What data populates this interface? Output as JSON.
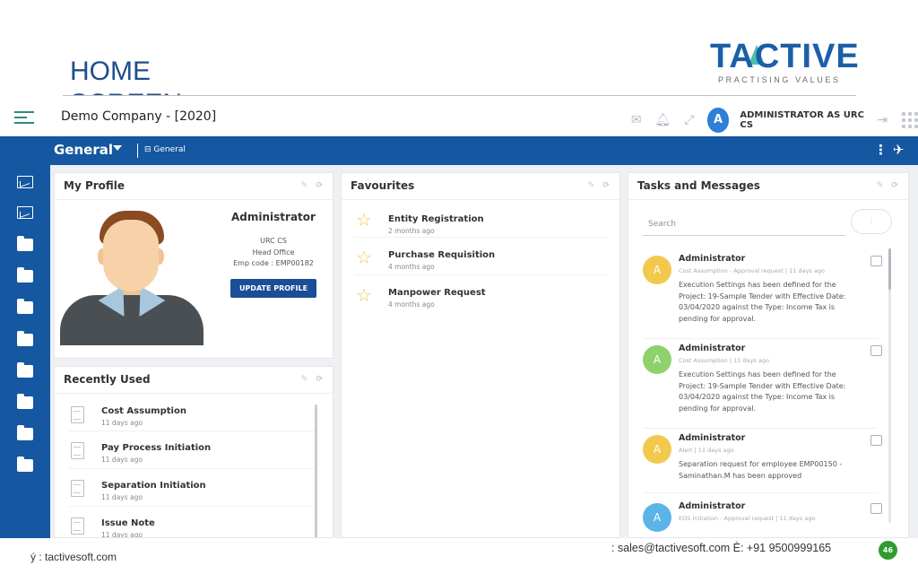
{
  "slide": {
    "title_line1": "HOME",
    "title_line2": "SCREEN",
    "logo_text": "TACTIVE",
    "logo_tagline": "PRACTISING VALUES"
  },
  "topbar": {
    "company": "Demo Company - [2020]",
    "avatar_letter": "A",
    "user": "ADMINISTRATOR AS URC CS",
    "icons": [
      "mail-icon",
      "bell-icon",
      "expand-icon",
      "logout-icon",
      "apps-grid-icon"
    ]
  },
  "nav": {
    "title": "General",
    "crumb": "⊟ General",
    "menu_glyph": "⋮",
    "pin_glyph": "✈"
  },
  "sidebar": {
    "items": [
      "chart-icon",
      "chart-icon",
      "folder-icon",
      "folder-icon",
      "folder-icon",
      "folder-icon",
      "folder-icon",
      "folder-icon",
      "folder-icon",
      "folder-icon"
    ]
  },
  "profile": {
    "heading": "My Profile",
    "name": "Administrator",
    "company": "URC CS",
    "office": "Head Office",
    "emp_code": "Emp code : EMP00182",
    "button": "UPDATE PROFILE"
  },
  "recent": {
    "heading": "Recently Used",
    "items": [
      {
        "title": "Cost Assumption",
        "time": "11 days ago"
      },
      {
        "title": "Pay Process Initiation",
        "time": "11 days ago"
      },
      {
        "title": "Separation Initiation",
        "time": "11 days ago"
      },
      {
        "title": "Issue Note",
        "time": "11 days ago"
      }
    ]
  },
  "favourites": {
    "heading": "Favourites",
    "items": [
      {
        "title": "Entity Registration",
        "time": "2 months ago"
      },
      {
        "title": "Purchase Requisition",
        "time": "4 months ago"
      },
      {
        "title": "Manpower Request",
        "time": "4 months ago"
      }
    ]
  },
  "tasks": {
    "heading": "Tasks and Messages",
    "search_placeholder": "Search",
    "messages": [
      {
        "letter": "A",
        "color": "#f2c94c",
        "name": "Administrator",
        "meta": "Cost Assumption - Approval request | 11 days ago",
        "text": "Execution Settings has been defined for the Project: 19-Sample Tender with Effective Date: 03/04/2020 against the Type: Income Tax is pending for approval."
      },
      {
        "letter": "A",
        "color": "#8fd16c",
        "name": "Administrator",
        "meta": "Cost Assumption | 11 days ago",
        "text": "Execution Settings has been defined for the Project: 19-Sample Tender with Effective Date: 03/04/2020 against the Type: Income Tax is pending for approval."
      },
      {
        "letter": "A",
        "color": "#f2c94c",
        "name": "Administrator",
        "meta": "Alert | 11 days ago",
        "text": "Separation request  for employee  EMP00150 - Saminathan.M  has been approved"
      },
      {
        "letter": "A",
        "color": "#5ab4e8",
        "name": "Administrator",
        "meta": "EOS Initiation - Approval request | 11 days ago",
        "text": ""
      }
    ]
  },
  "footer": {
    "website": "ý : tactivesoft.com",
    "contact": ": sales@tactivesoft.com    È: +91 9500999165",
    "page": "46"
  },
  "colors": {
    "brand_blue": "#1557a0",
    "button_blue": "#1a4e96",
    "star": "#f2c94c",
    "page_badge": "#2e9c2e"
  }
}
